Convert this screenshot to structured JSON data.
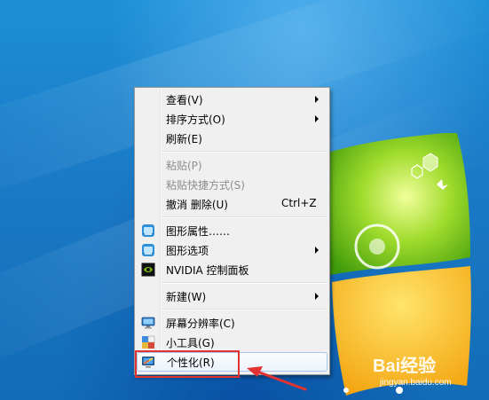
{
  "context_menu": {
    "items": [
      {
        "label": "查看(V)",
        "submenu": true
      },
      {
        "label": "排序方式(O)",
        "submenu": true
      },
      {
        "label": "刷新(E)"
      },
      {
        "label": "粘贴(P)",
        "disabled": true
      },
      {
        "label": "粘贴快捷方式(S)",
        "disabled": true
      },
      {
        "label": "撤消 删除(U)",
        "shortcut": "Ctrl+Z"
      },
      {
        "label": "图形属性……",
        "icon": "intel-graphics-icon"
      },
      {
        "label": "图形选项",
        "icon": "intel-graphics-icon",
        "submenu": true
      },
      {
        "label": "NVIDIA 控制面板",
        "icon": "nvidia-icon"
      },
      {
        "label": "新建(W)",
        "submenu": true
      },
      {
        "label": "屏幕分辨率(C)",
        "icon": "monitor-icon"
      },
      {
        "label": "小工具(G)",
        "icon": "gadgets-icon"
      },
      {
        "label": "个性化(R)",
        "icon": "personalize-icon",
        "highlighted": true
      }
    ]
  },
  "annotation": {
    "color": "#e23232",
    "target": "个性化(R)"
  },
  "watermark": {
    "brand": "Bai经验",
    "url": "jingyan.baidu.com"
  },
  "colors": {
    "desktop": "#1a7ac6",
    "menu_bg": "#f0f0f0",
    "annotation": "#e23232"
  }
}
